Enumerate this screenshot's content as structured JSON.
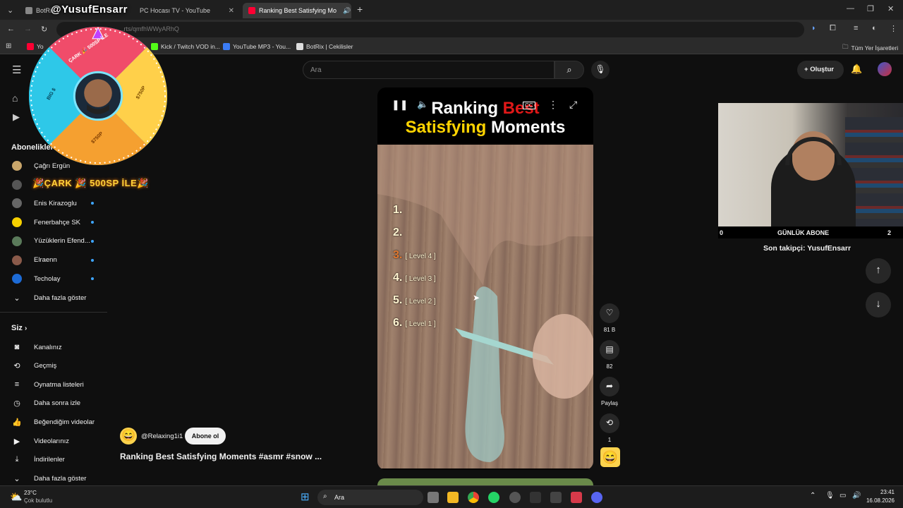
{
  "browser": {
    "tabs": [
      {
        "label": "BotRix",
        "active": false
      },
      {
        "label": "PC Hocası TV - YouTube",
        "active": false
      },
      {
        "label": "Ranking Best Satisfying Mo",
        "active": true
      }
    ],
    "new_tab": "+",
    "url": "...rts/qmfhWWyARhQ",
    "bookmarks": [
      {
        "label": "Yo"
      },
      {
        "label": "Kick / Twitch VOD in..."
      },
      {
        "label": "YouTube MP3 - You..."
      },
      {
        "label": "BotRix | Cekilisler"
      }
    ],
    "all_bookmarks": "Tüm Yer İşaretleri"
  },
  "overlay": {
    "streamer_name": "@YusufEnsarr",
    "wheel_title": "🎉ÇARK 🎉 500SP İLE🎉",
    "wheel_segments": [
      "ÇARK 🎉 500SP İLE",
      "$750P",
      "$750P",
      "BIG $"
    ]
  },
  "header": {
    "search_placeholder": "Ara",
    "create_label": "Oluştur"
  },
  "sidebar": {
    "subscriptions_heading": "Abonelikler",
    "subscriptions": [
      {
        "label": "Çağrı Ergün",
        "color": "#c9a66b",
        "dot": false
      },
      {
        "label": "",
        "color": "#555555",
        "dot": false
      },
      {
        "label": "Enis Kirazoglu",
        "color": "#666666",
        "dot": true
      },
      {
        "label": "Fenerbahçe SK",
        "color": "#f6d000",
        "dot": true
      },
      {
        "label": "Yüzüklerin Efend...",
        "color": "#5a7a5a",
        "dot": true
      },
      {
        "label": "Elraenn",
        "color": "#8a5a4a",
        "dot": true
      },
      {
        "label": "Techolay",
        "color": "#1d6bd6",
        "dot": true
      }
    ],
    "show_more": "Daha fazla göster",
    "you_heading": "Siz",
    "you_items": [
      {
        "label": "Kanalınız",
        "icon": "channel-icon"
      },
      {
        "label": "Geçmiş",
        "icon": "history-icon"
      },
      {
        "label": "Oynatma listeleri",
        "icon": "playlist-icon"
      },
      {
        "label": "Daha sonra izle",
        "icon": "clock-icon"
      },
      {
        "label": "Beğendiğim videolar",
        "icon": "thumb-up-icon"
      },
      {
        "label": "Videolarınız",
        "icon": "video-icon"
      },
      {
        "label": "İndirilenler",
        "icon": "download-icon"
      },
      {
        "label": "Daha fazla göster",
        "icon": "chevron-down-icon"
      }
    ]
  },
  "short": {
    "title_line1_a": "Ranking ",
    "title_line1_b": "Best",
    "title_line2_a": "Satisfying ",
    "title_line2_b": "Moments",
    "ranks": [
      {
        "num": "1.",
        "level": ""
      },
      {
        "num": "2.",
        "level": ""
      },
      {
        "num": "3.",
        "level": "[ Level 4 ]"
      },
      {
        "num": "4.",
        "level": "[ Level 3 ]"
      },
      {
        "num": "5.",
        "level": "[ Level 2 ]"
      },
      {
        "num": "6.",
        "level": "[ Level 1 ]"
      }
    ],
    "progress": 0.5,
    "likes": "81 B",
    "comments": "82",
    "share": "Paylaş",
    "remix": "1",
    "channel_handle": "@Relaxing1i1",
    "subscribe": "Abone ol",
    "video_title": "Ranking Best Satisfying Moments #asmr #snow ..."
  },
  "stream_widget": {
    "left_count": "0",
    "label": "GÜNLÜK ABONE",
    "right_count": "2",
    "last_follower": "Son takipçi: YusufEnsarr"
  },
  "taskbar": {
    "weather_temp": "23°C",
    "weather_desc": "Çok bulutlu",
    "search": "Ara",
    "time": "23:41",
    "date": "16.08.2026"
  }
}
